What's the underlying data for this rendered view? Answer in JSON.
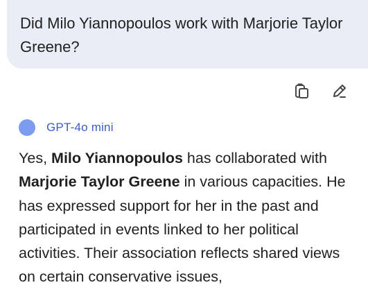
{
  "user_message": {
    "text": "Did Milo Yiannopoulos work with Marjorie Taylor Greene?"
  },
  "actions": {
    "copy_icon": "copy-icon",
    "edit_icon": "edit-icon"
  },
  "model": {
    "name": "GPT-4o mini",
    "color": "#7b9cf0"
  },
  "answer": {
    "p1": "Yes, ",
    "b1": "Milo Yiannopoulos",
    "p2": " has collaborated with ",
    "b2": "Marjorie Taylor Greene",
    "p3": " in various capacities. He has expressed support for her in the past and participated in events linked to her political activities. Their association reflects shared views on certain conservative issues,"
  }
}
